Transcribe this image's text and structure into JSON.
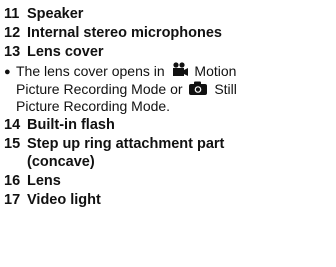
{
  "items": [
    {
      "num": "11",
      "label": "Speaker"
    },
    {
      "num": "12",
      "label": "Internal stereo microphones"
    },
    {
      "num": "13",
      "label": "Lens cover"
    },
    {
      "num": "14",
      "label": "Built-in flash"
    },
    {
      "num": "15",
      "label": "Step up ring attachment part",
      "label_cont": "(concave)"
    },
    {
      "num": "16",
      "label": "Lens"
    },
    {
      "num": "17",
      "label": "Video light"
    }
  ],
  "note": {
    "bullet": "●",
    "line1_pre": "The lens cover opens in",
    "line1_post": "Motion",
    "line2_pre": "Picture Recording Mode or",
    "line2_post": "Still",
    "line3": "Picture Recording Mode.",
    "icons": [
      "motion-picture-mode-icon",
      "still-picture-mode-icon"
    ]
  }
}
